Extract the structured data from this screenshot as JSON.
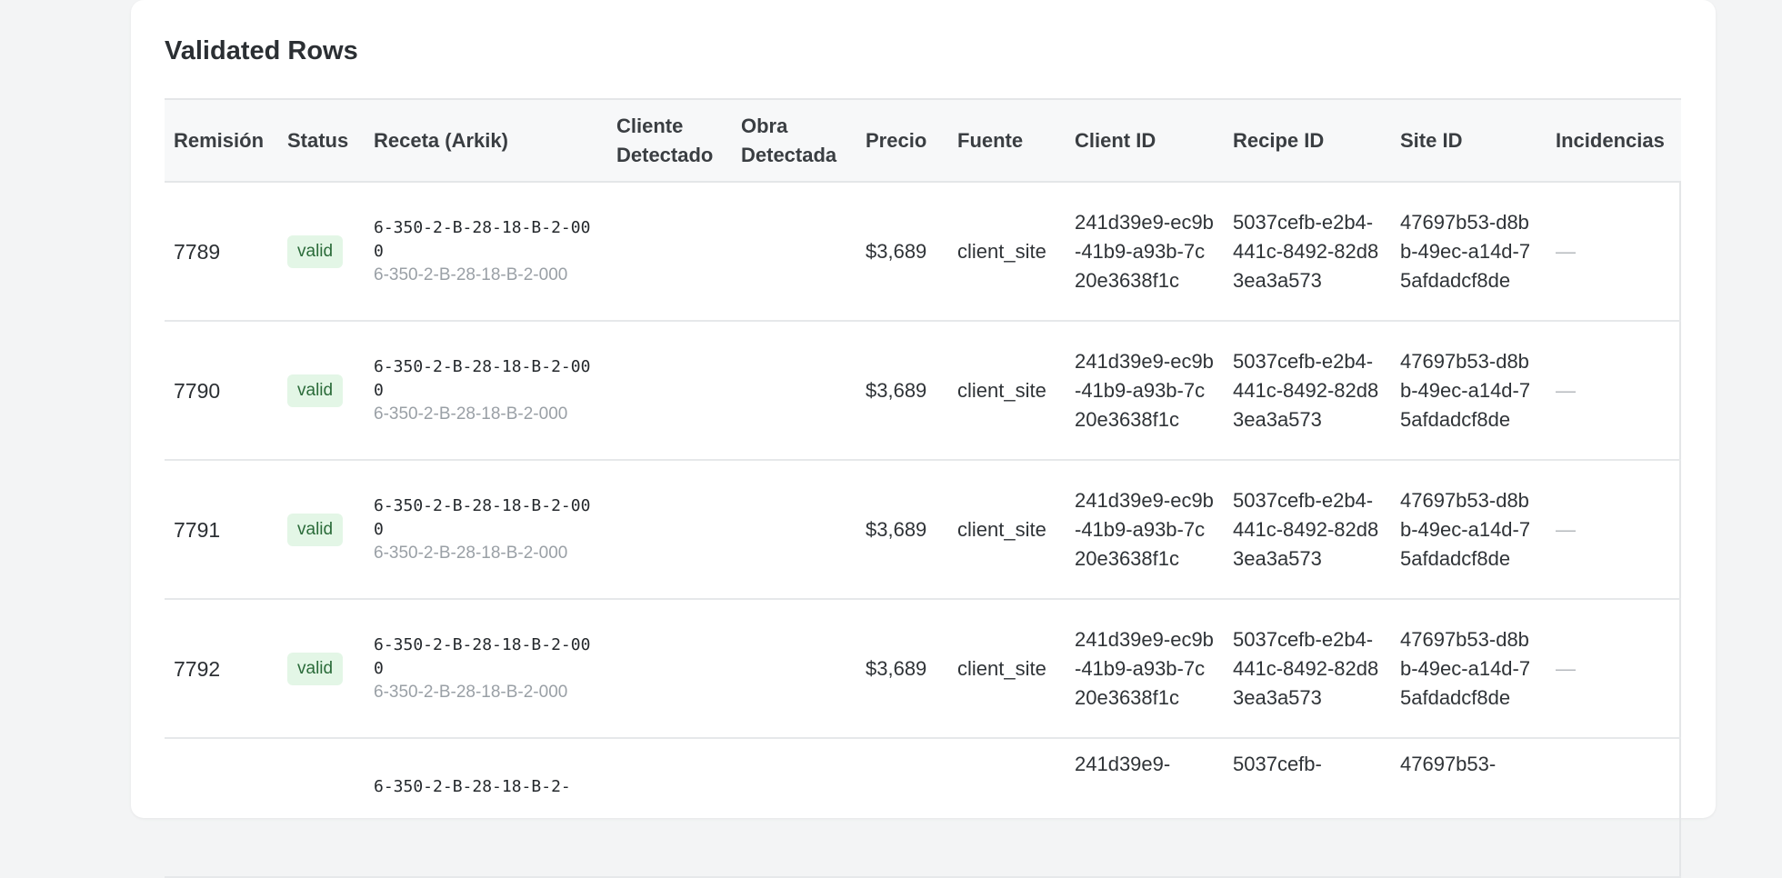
{
  "card": {
    "title": "Validated Rows"
  },
  "table": {
    "columns": [
      "Remisión",
      "Status",
      "Receta (Arkik)",
      "Cliente Detectado",
      "Obra Detectada",
      "Precio",
      "Fuente",
      "Client ID",
      "Recipe ID",
      "Site ID",
      "Incidencias"
    ],
    "rows": [
      {
        "remision": "7789",
        "status": "valid",
        "receta": "6-350-2-B-28-18-B-2-000",
        "receta_sub": "6-350-2-B-28-18-B-2-000",
        "cliente": "",
        "obra": "",
        "precio": "$3,689",
        "fuente": "client_site",
        "client_id": "241d39e9-ec9b-41b9-a93b-7c20e3638f1c",
        "recipe_id": "5037cefb-e2b4-441c-8492-82d83ea3a573",
        "site_id": "47697b53-d8bb-49ec-a14d-75afdadcf8de",
        "incidencias": "—"
      },
      {
        "remision": "7790",
        "status": "valid",
        "receta": "6-350-2-B-28-18-B-2-000",
        "receta_sub": "6-350-2-B-28-18-B-2-000",
        "cliente": "",
        "obra": "",
        "precio": "$3,689",
        "fuente": "client_site",
        "client_id": "241d39e9-ec9b-41b9-a93b-7c20e3638f1c",
        "recipe_id": "5037cefb-e2b4-441c-8492-82d83ea3a573",
        "site_id": "47697b53-d8bb-49ec-a14d-75afdadcf8de",
        "incidencias": "—"
      },
      {
        "remision": "7791",
        "status": "valid",
        "receta": "6-350-2-B-28-18-B-2-000",
        "receta_sub": "6-350-2-B-28-18-B-2-000",
        "cliente": "",
        "obra": "",
        "precio": "$3,689",
        "fuente": "client_site",
        "client_id": "241d39e9-ec9b-41b9-a93b-7c20e3638f1c",
        "recipe_id": "5037cefb-e2b4-441c-8492-82d83ea3a573",
        "site_id": "47697b53-d8bb-49ec-a14d-75afdadcf8de",
        "incidencias": "—"
      },
      {
        "remision": "7792",
        "status": "valid",
        "receta": "6-350-2-B-28-18-B-2-000",
        "receta_sub": "6-350-2-B-28-18-B-2-000",
        "cliente": "",
        "obra": "",
        "precio": "$3,689",
        "fuente": "client_site",
        "client_id": "241d39e9-ec9b-41b9-a93b-7c20e3638f1c",
        "recipe_id": "5037cefb-e2b4-441c-8492-82d83ea3a573",
        "site_id": "47697b53-d8bb-49ec-a14d-75afdadcf8de",
        "incidencias": "—"
      },
      {
        "remision": "",
        "status": "",
        "receta": "6-350-2-B-28-18-B-2-",
        "receta_sub": "",
        "cliente": "",
        "obra": "",
        "precio": "",
        "fuente": "",
        "client_id": "241d39e9-",
        "recipe_id": "5037cefb-",
        "site_id": "47697b53-",
        "incidencias": ""
      }
    ]
  },
  "colors": {
    "badge_bg": "#e3f6e6",
    "badge_text": "#2a6b39",
    "page_bg": "#f3f4f5"
  }
}
